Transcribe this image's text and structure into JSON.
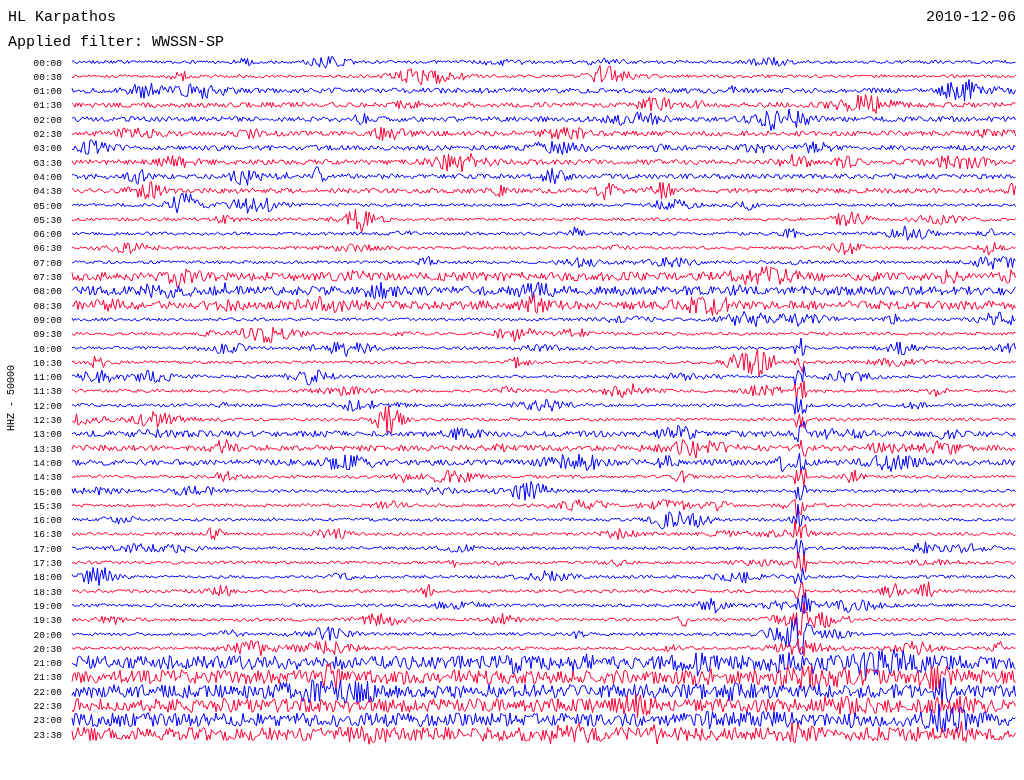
{
  "header": {
    "station": "HL Karpathos",
    "date": "2010-12-06",
    "filter": "Applied filter: WWSSN-SP"
  },
  "axis": {
    "channel_label": "HHZ - 50000"
  },
  "traces": [
    {
      "time": "00:00",
      "color": "#0000ff"
    },
    {
      "time": "00:30",
      "color": "#ff0033"
    },
    {
      "time": "01:00",
      "color": "#0000ff"
    },
    {
      "time": "01:30",
      "color": "#ff0033"
    },
    {
      "time": "02:00",
      "color": "#0000ff"
    },
    {
      "time": "02:30",
      "color": "#ff0033"
    },
    {
      "time": "03:00",
      "color": "#0000ff"
    },
    {
      "time": "03:30",
      "color": "#ff0033"
    },
    {
      "time": "04:00",
      "color": "#0000ff"
    },
    {
      "time": "04:30",
      "color": "#ff0033"
    },
    {
      "time": "05:00",
      "color": "#0000ff"
    },
    {
      "time": "05:30",
      "color": "#ff0033"
    },
    {
      "time": "06:00",
      "color": "#0000ff"
    },
    {
      "time": "06:30",
      "color": "#ff0033"
    },
    {
      "time": "07:00",
      "color": "#0000ff"
    },
    {
      "time": "07:30",
      "color": "#ff0033"
    },
    {
      "time": "08:00",
      "color": "#0000ff"
    },
    {
      "time": "08:30",
      "color": "#ff0033"
    },
    {
      "time": "09:00",
      "color": "#0000ff"
    },
    {
      "time": "09:30",
      "color": "#ff0033"
    },
    {
      "time": "10:00",
      "color": "#0000ff"
    },
    {
      "time": "10:30",
      "color": "#ff0033"
    },
    {
      "time": "11:00",
      "color": "#0000ff"
    },
    {
      "time": "11:30",
      "color": "#ff0033"
    },
    {
      "time": "12:00",
      "color": "#0000ff"
    },
    {
      "time": "12:30",
      "color": "#ff0033"
    },
    {
      "time": "13:00",
      "color": "#0000ff"
    },
    {
      "time": "13:30",
      "color": "#ff0033"
    },
    {
      "time": "14:00",
      "color": "#0000ff"
    },
    {
      "time": "14:30",
      "color": "#ff0033"
    },
    {
      "time": "15:00",
      "color": "#0000ff"
    },
    {
      "time": "15:30",
      "color": "#ff0033"
    },
    {
      "time": "16:00",
      "color": "#0000ff"
    },
    {
      "time": "16:30",
      "color": "#ff0033"
    },
    {
      "time": "17:00",
      "color": "#0000ff"
    },
    {
      "time": "17:30",
      "color": "#ff0033"
    },
    {
      "time": "18:00",
      "color": "#0000ff"
    },
    {
      "time": "18:30",
      "color": "#ff0033"
    },
    {
      "time": "19:00",
      "color": "#0000ff"
    },
    {
      "time": "19:30",
      "color": "#ff0033"
    },
    {
      "time": "20:00",
      "color": "#0000ff"
    },
    {
      "time": "20:30",
      "color": "#ff0033"
    },
    {
      "time": "21:00",
      "color": "#0000ff"
    },
    {
      "time": "21:30",
      "color": "#ff0033"
    },
    {
      "time": "22:00",
      "color": "#0000ff"
    },
    {
      "time": "22:30",
      "color": "#ff0033"
    },
    {
      "time": "23:00",
      "color": "#0000ff"
    },
    {
      "time": "23:30",
      "color": "#ff0033"
    }
  ]
}
